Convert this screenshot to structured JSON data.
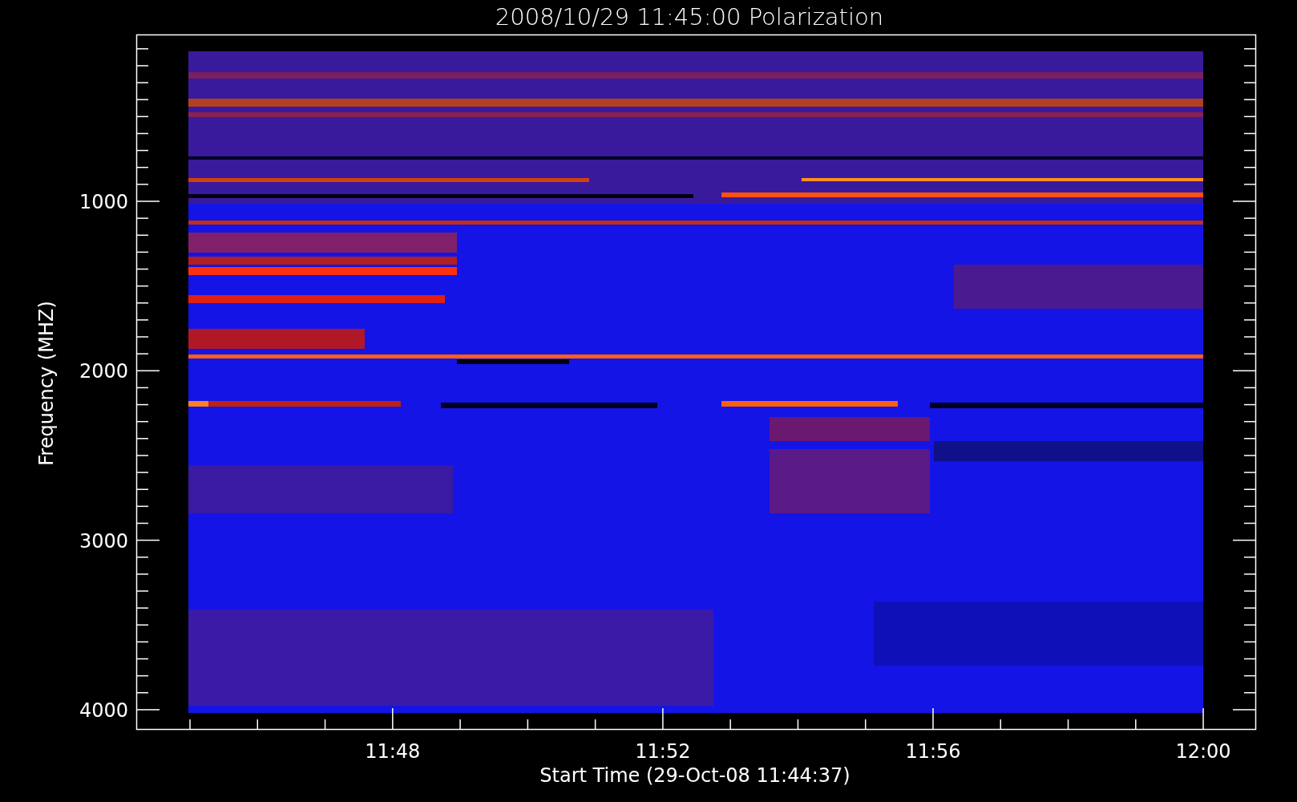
{
  "title": "2008/10/29 11:45:00 Polarization",
  "plot": {
    "kind": "spectrogram",
    "y_axis": {
      "label": "Frequency (MHZ)",
      "ticks": [
        "1000",
        "2000",
        "3000",
        "4000"
      ]
    },
    "x_axis": {
      "label": "Start Time (29-Oct-08 11:44:37)",
      "ticks": [
        "11:48",
        "11:52",
        "11:56",
        "12:00"
      ]
    }
  }
}
